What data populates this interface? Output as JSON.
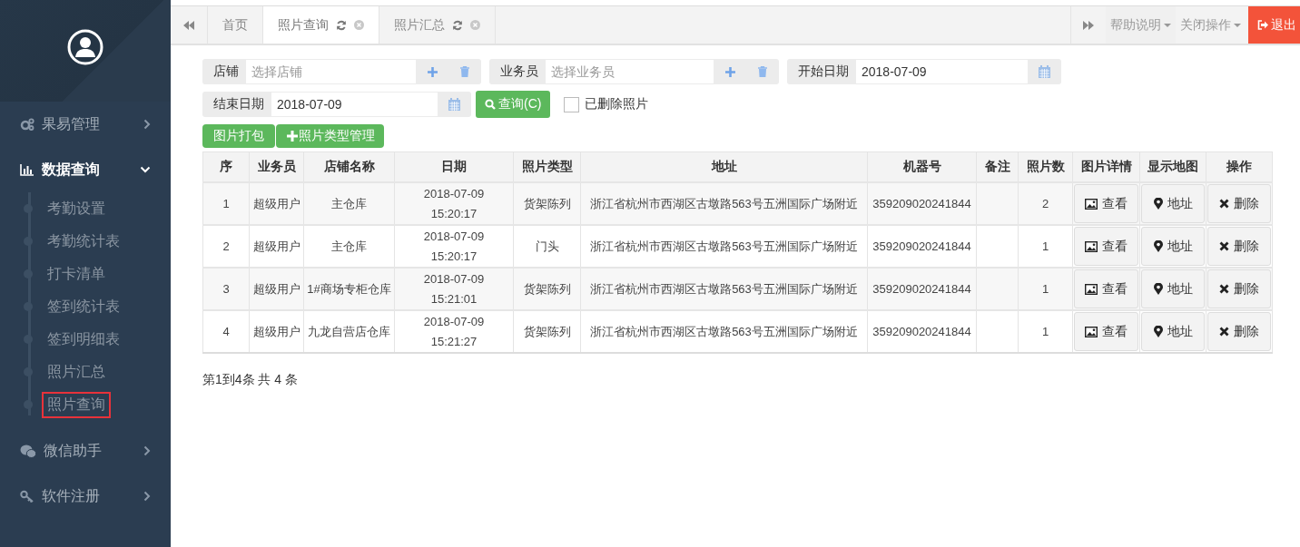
{
  "sidebar": {
    "items": [
      {
        "label": "果易管理",
        "expanded": false
      },
      {
        "label": "数据查询",
        "expanded": true,
        "children": [
          {
            "label": "考勤设置",
            "highlighted": false
          },
          {
            "label": "考勤统计表",
            "highlighted": false
          },
          {
            "label": "打卡清单",
            "highlighted": false
          },
          {
            "label": "签到统计表",
            "highlighted": false
          },
          {
            "label": "签到明细表",
            "highlighted": false
          },
          {
            "label": "照片汇总",
            "highlighted": false
          },
          {
            "label": "照片查询",
            "highlighted": true
          }
        ]
      },
      {
        "label": "微信助手",
        "expanded": false
      },
      {
        "label": "软件注册",
        "expanded": false
      }
    ]
  },
  "tabs": [
    {
      "label": "首页",
      "selected": false,
      "closable": false
    },
    {
      "label": "照片查询",
      "selected": true,
      "closable": true
    },
    {
      "label": "照片汇总",
      "selected": false,
      "closable": true
    }
  ],
  "toolbar": {
    "help": "帮助说明",
    "close_ops": "关闭操作",
    "logout": "退出"
  },
  "filters": {
    "fields": [
      {
        "label": "店铺",
        "placeholder": "选择店铺",
        "kind": "picker"
      },
      {
        "label": "业务员",
        "placeholder": "选择业务员",
        "kind": "picker"
      },
      {
        "label": "开始日期",
        "value": "2018-07-09",
        "kind": "date"
      },
      {
        "label": "结束日期",
        "value": "2018-07-09",
        "kind": "date"
      }
    ],
    "query_button": "查询(C)",
    "deleted_checkbox": {
      "label": "已删除照片",
      "checked": false
    },
    "pack_button": "图片打包",
    "type_button": "照片类型管理"
  },
  "table": {
    "columns": [
      "序",
      "业务员",
      "店铺名称",
      "日期",
      "照片类型",
      "地址",
      "机器号",
      "备注",
      "照片数",
      "图片详情",
      "显示地图",
      "操作"
    ],
    "rows": [
      {
        "no": "1",
        "salesman": "超级用户",
        "store": "主仓库",
        "date": "2018-07-09 15:20:17",
        "type": "货架陈列",
        "address": "浙江省杭州市西湖区古墩路563号五洲国际广场附近",
        "machine": "359209020241844",
        "photos": "2",
        "view": "查看",
        "map": "地址",
        "delete": "删除"
      },
      {
        "no": "2",
        "salesman": "超级用户",
        "store": "主仓库",
        "date": "2018-07-09 15:20:17",
        "type": "门头",
        "address": "浙江省杭州市西湖区古墩路563号五洲国际广场附近",
        "machine": "359209020241844",
        "photos": "1",
        "view": "查看",
        "map": "地址",
        "delete": "删除"
      },
      {
        "no": "3",
        "salesman": "超级用户",
        "store": "1#商场专柜仓库",
        "date": "2018-07-09 15:21:01",
        "type": "货架陈列",
        "address": "浙江省杭州市西湖区古墩路563号五洲国际广场附近",
        "machine": "359209020241844",
        "photos": "1",
        "view": "查看",
        "map": "地址",
        "delete": "删除"
      },
      {
        "no": "4",
        "salesman": "超级用户",
        "store": "九龙自营店仓库",
        "date": "2018-07-09 15:21:27",
        "type": "货架陈列",
        "address": "浙江省杭州市西湖区古墩路563号五洲国际广场附近",
        "machine": "359209020241844",
        "photos": "1",
        "view": "查看",
        "map": "地址",
        "delete": "删除"
      }
    ]
  },
  "pagination": "第1到4条 共 4 条"
}
